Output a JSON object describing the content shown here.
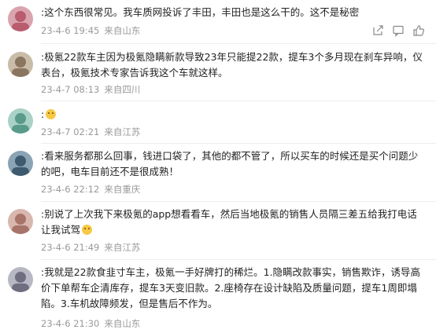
{
  "comments": [
    {
      "username": "",
      "text": ":这个东西很常见。我车质网投诉了丰田，丰田也是这么干的。这不是秘密",
      "emoji": false,
      "date": "23-4-6 19:45",
      "location": "来自山东",
      "avatar_color": "#b85c6e"
    },
    {
      "username": "",
      "text": ":极氪22款车主因为极氪隐瞒新款导致23年只能提22款，提车3个多月现在刹车异响，仪表台，极氪技术专家告诉我这个车就这样。",
      "emoji": false,
      "date": "23-4-7 08:13",
      "location": "来自四川",
      "avatar_color": "#8a7560"
    },
    {
      "username": "",
      "text": ":",
      "emoji": true,
      "date": "23-4-7 02:21",
      "location": "来自江苏",
      "avatar_color": "#5a9a8a"
    },
    {
      "username": "",
      "text": ":看来服务都那么回事，钱进口袋了，其他的都不管了，所以买车的时候还是买个问题少的吧，电车目前还不是很成熟！",
      "emoji": false,
      "date": "23-4-6 22:12",
      "location": "来自重庆",
      "avatar_color": "#3d5a6e"
    },
    {
      "username": "",
      "text": ":别说了上次我下来极氪的app想看看车，然后当地极氪的销售人员隔三差五给我打电话让我试驾",
      "emoji": true,
      "date": "23-4-6 21:49",
      "location": "来自江苏",
      "avatar_color": "#a8746a"
    },
    {
      "username": "",
      "text": ":我就是22款食韭寸车主，极氪一手好牌打的稀烂。1.隐瞒改款事实，销售欺诈，诱导高价下单帮车企清库存，提车3天变旧款。2.座椅存在设计缺陷及质量问题，提车1周即塌陷。3.车机故障频发，但是售后不作为。",
      "emoji": false,
      "date": "23-4-6 21:30",
      "location": "来自山东",
      "avatar_color": "#6e6e80"
    }
  ],
  "action_icons": [
    "share-icon",
    "comment-icon",
    "like-icon"
  ]
}
